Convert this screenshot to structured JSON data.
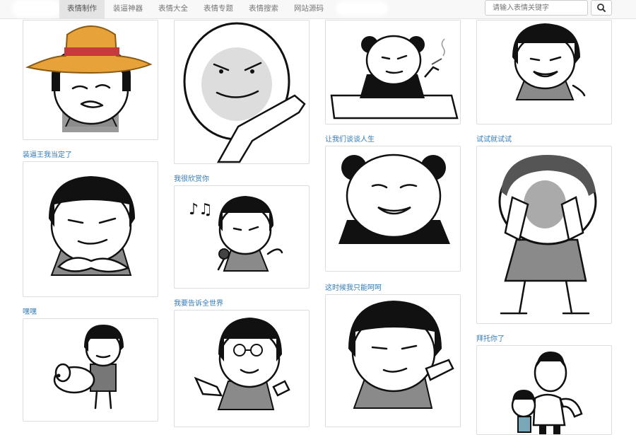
{
  "nav": {
    "items": [
      {
        "label": "表情制作",
        "active": true
      },
      {
        "label": "装逼神器",
        "active": false
      },
      {
        "label": "表情大全",
        "active": false
      },
      {
        "label": "表情专题",
        "active": false
      },
      {
        "label": "表情搜索",
        "active": false
      },
      {
        "label": "网站源码",
        "active": false
      }
    ],
    "search": {
      "placeholder": "请输入表情关键字",
      "button_icon": "search-icon"
    }
  },
  "captions": [
    "装逼王我当定了",
    "我很欣赏你",
    "让我们谈谈人生",
    "试试就试试",
    "嘿嘿",
    "我要告诉全世界",
    "这时候我只能呵呵",
    "拜托你了"
  ],
  "colors": {
    "link": "#337ab7",
    "hat_yellow": "#e8a23a",
    "hat_band": "#c43b3b"
  }
}
